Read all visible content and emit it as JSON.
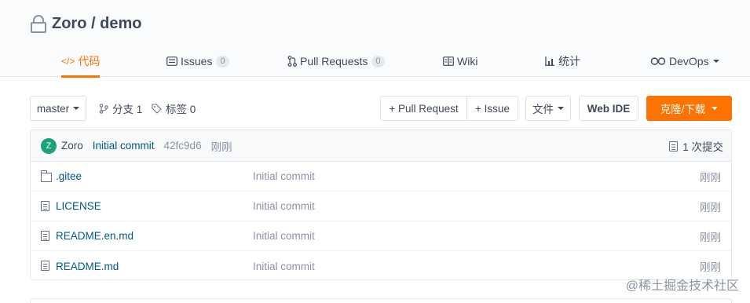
{
  "repo": {
    "title": "Zoro / demo",
    "icon": "lock-icon"
  },
  "tabs": [
    {
      "label": "代码",
      "icon": "code-icon",
      "active": true
    },
    {
      "label": "Issues",
      "icon": "issues-icon",
      "count": "0"
    },
    {
      "label": "Pull Requests",
      "icon": "pull-request-icon",
      "count": "0"
    },
    {
      "label": "Wiki",
      "icon": "wiki-icon"
    },
    {
      "label": "统计",
      "icon": "stats-icon"
    },
    {
      "label": "DevOps",
      "icon": "devops-icon"
    }
  ],
  "toolbar": {
    "branch": "master",
    "branches_label": "分支 1",
    "tags_label": "标签 0",
    "pull_request_label": "+ Pull Request",
    "issue_label": "+ Issue",
    "file_label": "文件",
    "webide_label": "Web IDE",
    "clone_label": "克隆/下载"
  },
  "last_commit": {
    "avatar_letter": "Z",
    "author": "Zoro",
    "message": "Initial commit",
    "hash": "42fc9d6",
    "time": "刚刚",
    "count_label": "1 次提交"
  },
  "files": [
    {
      "type": "folder",
      "name": ".gitee",
      "message": "Initial commit",
      "time": "刚刚"
    },
    {
      "type": "file",
      "name": "LICENSE",
      "message": "Initial commit",
      "time": "刚刚"
    },
    {
      "type": "file",
      "name": "README.en.md",
      "message": "Initial commit",
      "time": "刚刚"
    },
    {
      "type": "file",
      "name": "README.md",
      "message": "Initial commit",
      "time": "刚刚"
    }
  ],
  "watermark": "@稀土掘金技术社区",
  "colors": {
    "accent": "#fe7300",
    "link": "#005980",
    "muted": "#8c92a4",
    "avatar": "#1aa37a"
  }
}
